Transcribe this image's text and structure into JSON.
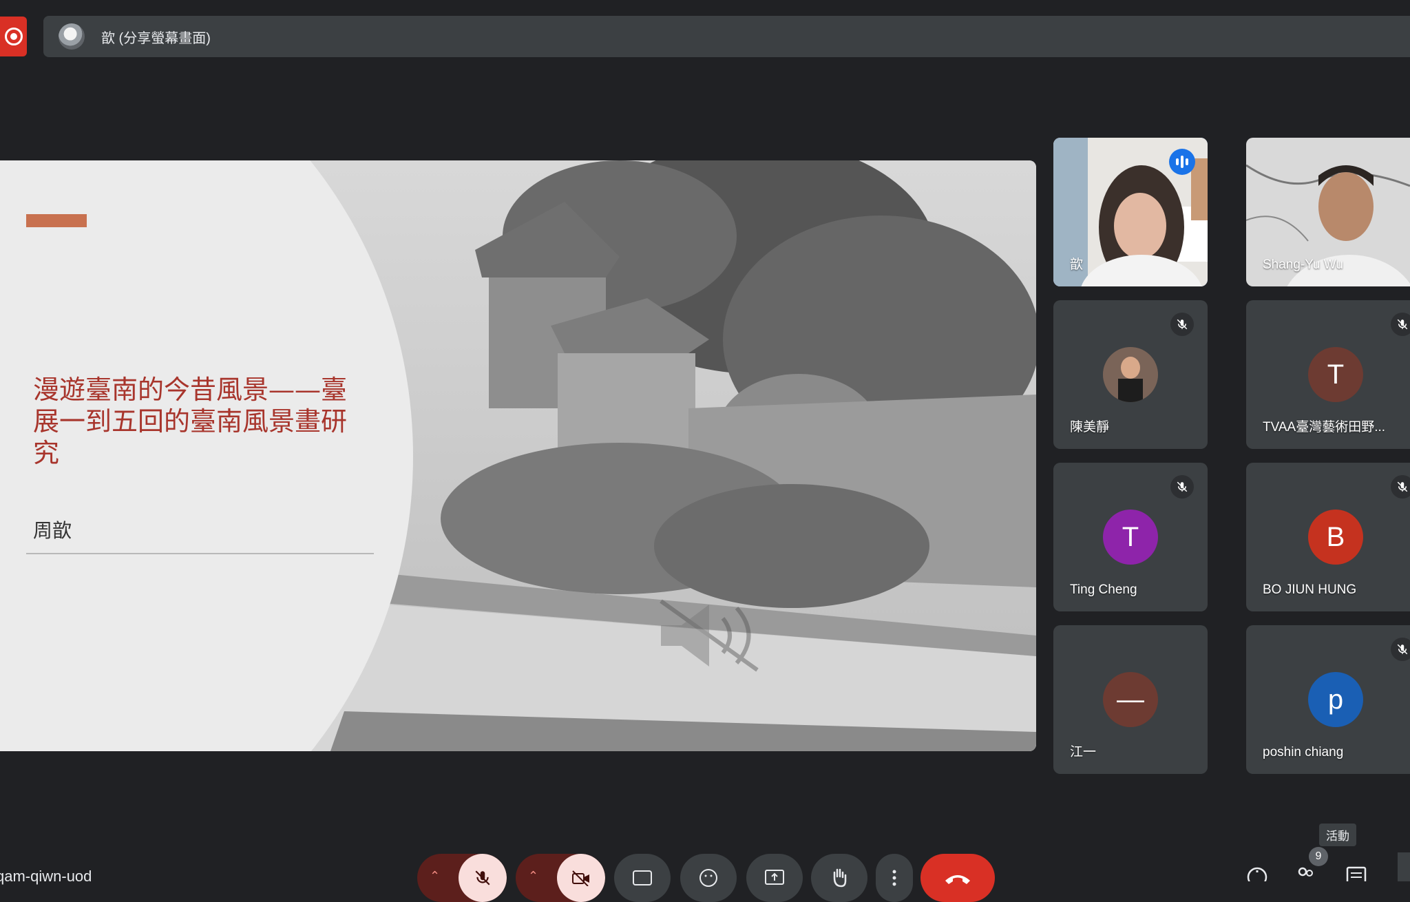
{
  "presenter_bar": {
    "label": "歆 (分享螢幕畫面)"
  },
  "slide": {
    "title": "漫遊臺南的今昔風景——臺展一到五回的臺南風景畫研究",
    "author": "周歆"
  },
  "participants": [
    {
      "name": "歆",
      "type": "video",
      "speaking": true
    },
    {
      "name": "Shang-Yu Wu",
      "type": "video",
      "speaking": false
    },
    {
      "name": "陳美靜",
      "type": "photo",
      "muted": true
    },
    {
      "name": "TVAA臺灣藝術田野...",
      "initial": "T",
      "color": "#6d3b32",
      "muted": true
    },
    {
      "name": "Ting Cheng",
      "initial": "T",
      "color": "#8e24aa",
      "muted": true
    },
    {
      "name": "BO JIUN HUNG",
      "initial": "B",
      "color": "#c5321f",
      "muted": true
    },
    {
      "name": "江一",
      "initial": "—",
      "color": "#6d3b32",
      "muted": false
    },
    {
      "name": "poshin chiang",
      "initial": "p",
      "color": "#1a5fb4",
      "muted": true
    }
  ],
  "bottom_bar": {
    "meeting_code": "qam-qiwn-uod",
    "tooltip": "活動",
    "participant_count": "9"
  },
  "colors": {
    "accent": "#8ab4f8",
    "end_call": "#d93025",
    "muted_bg": "#f9dedc"
  }
}
